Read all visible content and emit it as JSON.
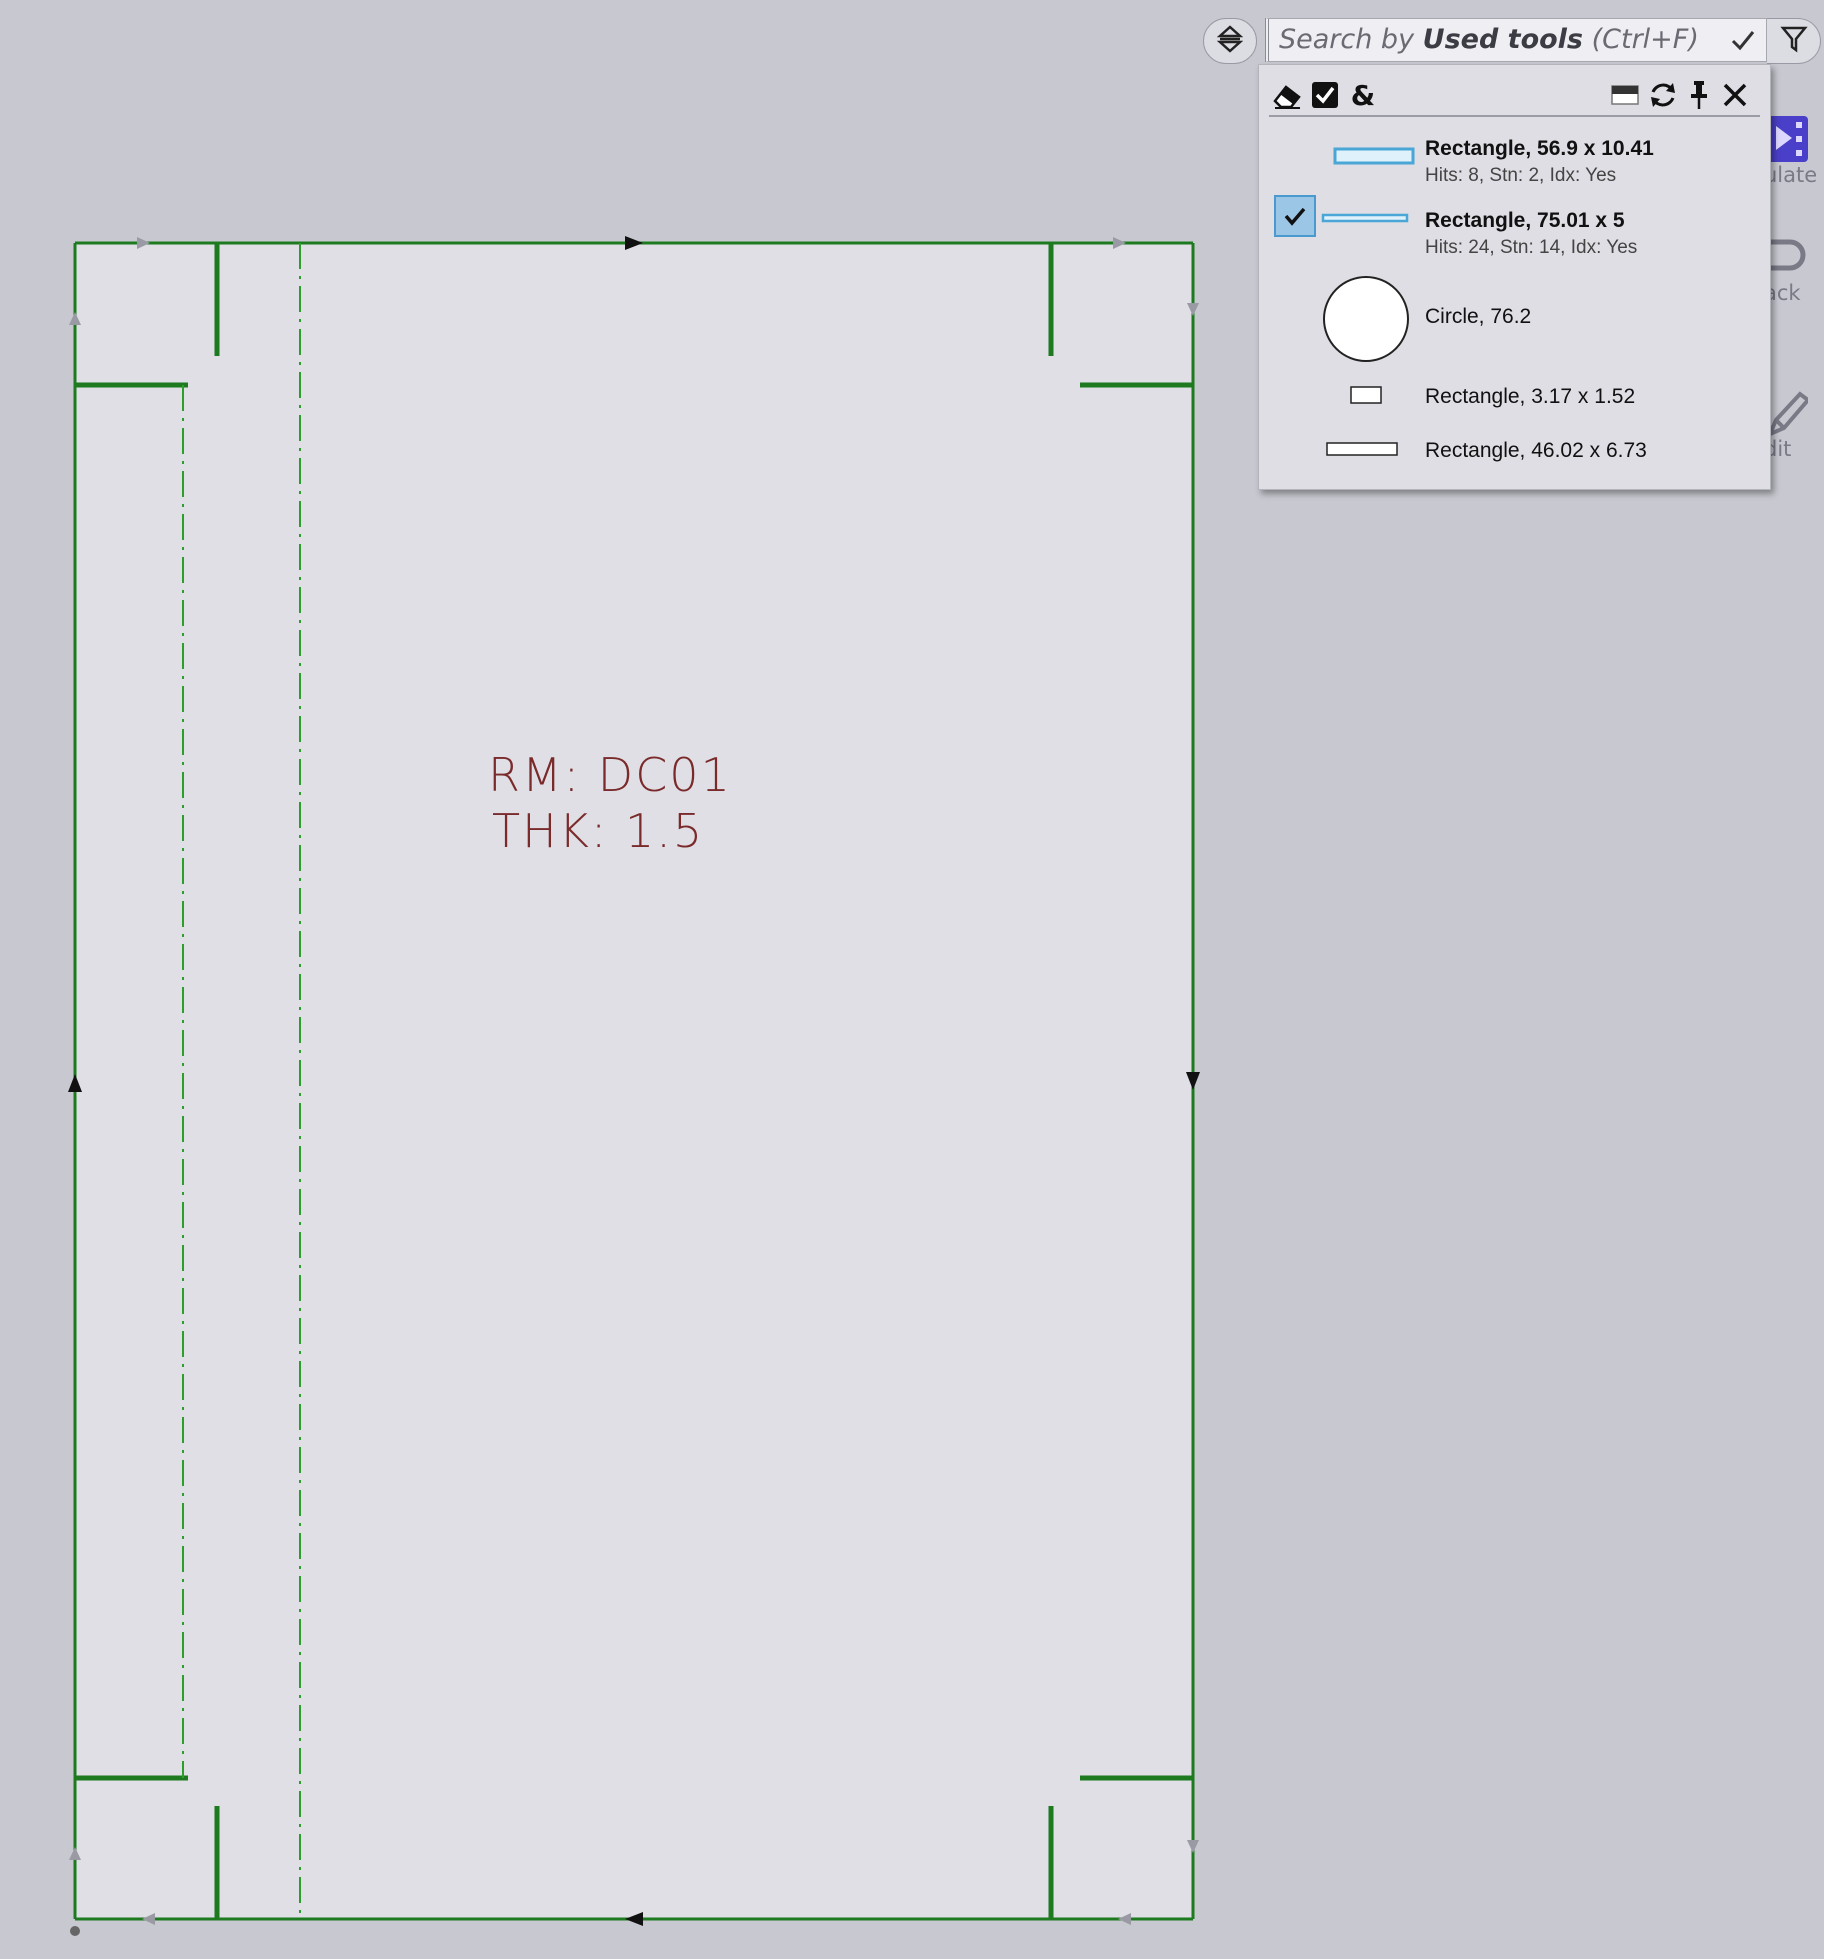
{
  "search": {
    "prefix": "Search by ",
    "field": "Used tools",
    "shortcut": " (Ctrl+F)"
  },
  "side_toolbar": [
    {
      "label": "ulate",
      "icon": "video-icon"
    },
    {
      "label": "ack",
      "icon": "loop-icon"
    },
    {
      "label": "dit",
      "icon": "pencil-icon"
    }
  ],
  "panel_toolbar": {
    "eraser": "eraser-icon",
    "select_all": "checkbox-icon",
    "and": "&",
    "window": "window-icon",
    "refresh": "refresh-icon",
    "pin": "pin-icon",
    "close": "close-icon"
  },
  "tools": [
    {
      "title": "Rectangle, 56.9 x 10.41",
      "subtitle": "Hits: 8, Stn: 2, Idx: Yes",
      "checked": true,
      "shape": "rectangle",
      "highlight": "#5ab4e0"
    },
    {
      "title": "Rectangle, 75.01 x 5",
      "subtitle": "Hits: 24, Stn: 14, Idx: Yes",
      "checked": false,
      "shape": "rectangle",
      "highlight": "#5ab4e0"
    },
    {
      "title": "Circle, 76.2",
      "subtitle": "",
      "checked": false,
      "shape": "circle"
    },
    {
      "title": "Rectangle, 3.17 x 1.52",
      "subtitle": "",
      "checked": false,
      "shape": "rectangle"
    },
    {
      "title": "Rectangle, 46.02 x 6.73",
      "subtitle": "",
      "checked": false,
      "shape": "rectangle"
    }
  ],
  "drawing": {
    "line1": "RM: DC01",
    "line2": "THK: 1.5",
    "line_color": "#1e7a1e",
    "text_color": "#7a2a2a",
    "sheet_color": "#dfdfe5"
  }
}
